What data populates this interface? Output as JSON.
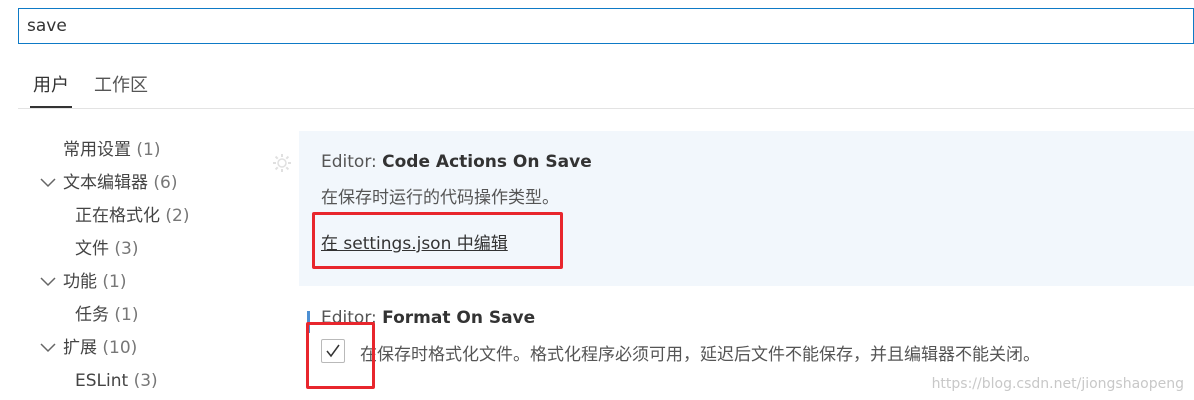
{
  "search": {
    "value": "save"
  },
  "tabs": [
    {
      "label": "用户",
      "active": true
    },
    {
      "label": "工作区",
      "active": false
    }
  ],
  "tree": [
    {
      "label": "常用设置",
      "count": "(1)",
      "expanded": null
    },
    {
      "label": "文本编辑器",
      "count": "(6)",
      "expanded": true
    },
    {
      "label": "正在格式化",
      "count": "(2)",
      "expanded": null
    },
    {
      "label": "文件",
      "count": "(3)",
      "expanded": null
    },
    {
      "label": "功能",
      "count": "(1)",
      "expanded": true
    },
    {
      "label": "任务",
      "count": "(1)",
      "expanded": null
    },
    {
      "label": "扩展",
      "count": "(10)",
      "expanded": true
    },
    {
      "label": "ESLint",
      "count": "(3)",
      "expanded": null
    }
  ],
  "settings": [
    {
      "category": "Editor: ",
      "name": "Code Actions On Save",
      "description": "在保存时运行的代码操作类型。",
      "edit_link": "在 settings.json 中编辑"
    },
    {
      "category": "Editor: ",
      "name": "Format On Save",
      "description": "在保存时格式化文件。格式化程序必须可用，延迟后文件不能保存，并且编辑器不能关闭。",
      "checked": true
    }
  ],
  "watermark": "https://blog.csdn.net/jiongshaopeng",
  "colors": {
    "accent": "#0e7ac6",
    "highlight_bg": "#f2f7fc",
    "annotation_red": "#e8262d",
    "modified_bar": "#4d8fd3"
  }
}
